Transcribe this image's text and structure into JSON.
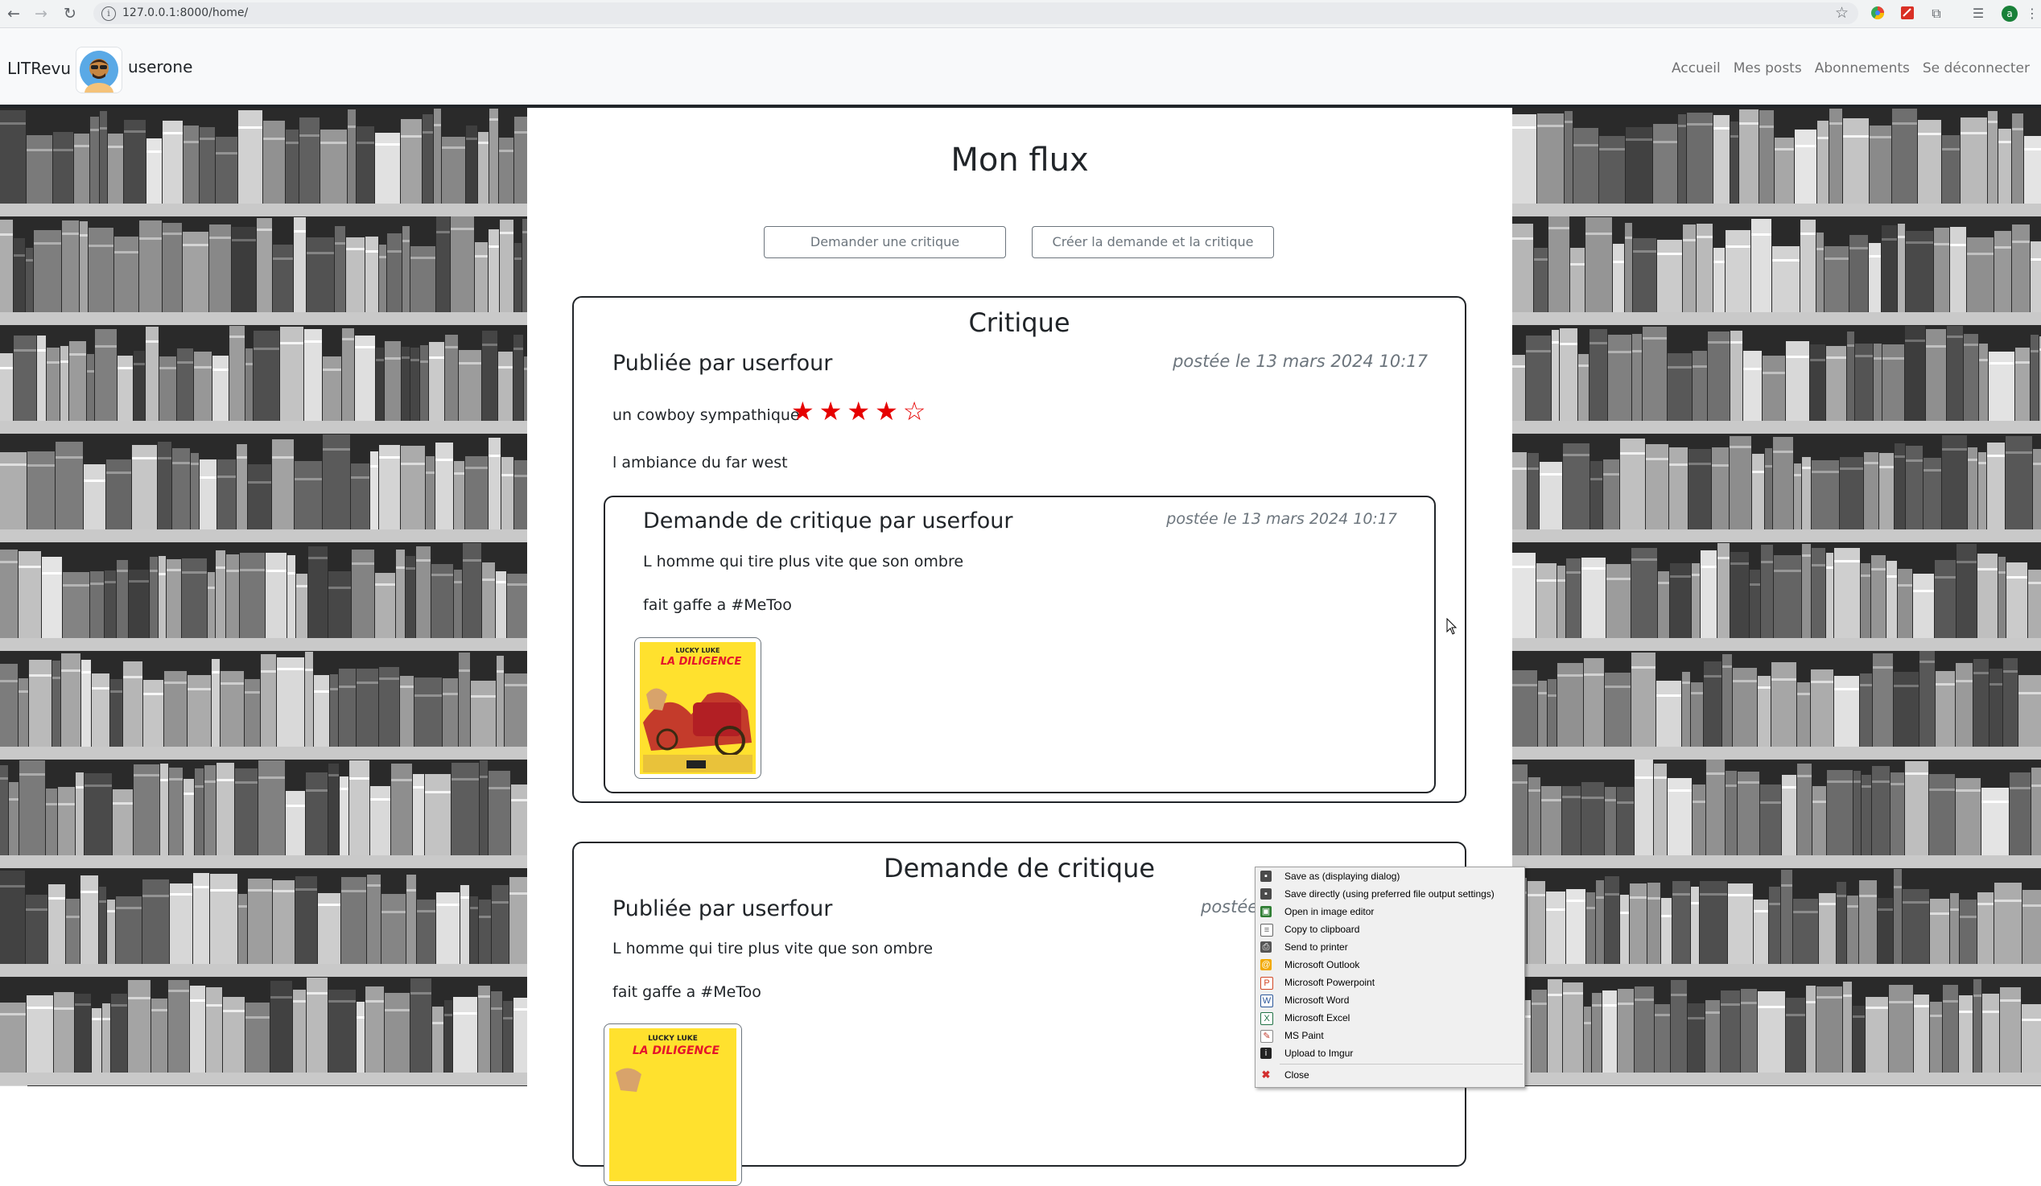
{
  "browser": {
    "url": "127.0.0.1:8000/home/",
    "profile_initial": "a"
  },
  "header": {
    "brand": "LITRevu",
    "username": "userone",
    "nav": [
      "Accueil",
      "Mes posts",
      "Abonnements",
      "Se déconnecter"
    ]
  },
  "main": {
    "title": "Mon flux",
    "buttons": {
      "ask_review": "Demander une critique",
      "create_both": "Créer la demande et la critique"
    }
  },
  "posts": [
    {
      "kind": "Critique",
      "published_by": "Publiée par userfour",
      "date": "postée le 13 mars 2024 10:17",
      "headline": "un cowboy sympathique",
      "rating": 4,
      "rating_max": 5,
      "stars": "★★★★☆",
      "body": "l ambiance du far west",
      "ticket": {
        "title": "Demande de critique par userfour",
        "date": "postée le 13 mars 2024 10:17",
        "book_title": "L homme qui tire plus vite que son ombre",
        "description": "fait gaffe a #MeToo",
        "cover": {
          "series": "LUCKY LUKE",
          "title": "LA DILIGENCE"
        }
      }
    },
    {
      "kind": "Demande de critique",
      "published_by": "Publiée par userfour",
      "date": "postée",
      "book_title": "L homme qui tire plus vite que son ombre",
      "description": "fait gaffe a #MeToo",
      "cover": {
        "series": "LUCKY LUKE",
        "title": "LA DILIGENCE"
      }
    }
  ],
  "context_menu": {
    "items": [
      {
        "label": "Save as (displaying dialog)",
        "icon": "floppy-disk-icon"
      },
      {
        "label": "Save directly (using preferred file output settings)",
        "icon": "floppy-disk-icon"
      },
      {
        "label": "Open in image editor",
        "icon": "image-editor-icon"
      },
      {
        "label": "Copy to clipboard",
        "icon": "clipboard-icon"
      },
      {
        "label": "Send to printer",
        "icon": "printer-icon"
      },
      {
        "label": "Microsoft Outlook",
        "icon": "outlook-icon"
      },
      {
        "label": "Microsoft Powerpoint",
        "icon": "powerpoint-icon"
      },
      {
        "label": "Microsoft Word",
        "icon": "word-icon"
      },
      {
        "label": "Microsoft Excel",
        "icon": "excel-icon"
      },
      {
        "label": "MS Paint",
        "icon": "paint-icon"
      },
      {
        "label": "Upload to Imgur",
        "icon": "imgur-icon"
      }
    ],
    "close_label": "Close"
  }
}
